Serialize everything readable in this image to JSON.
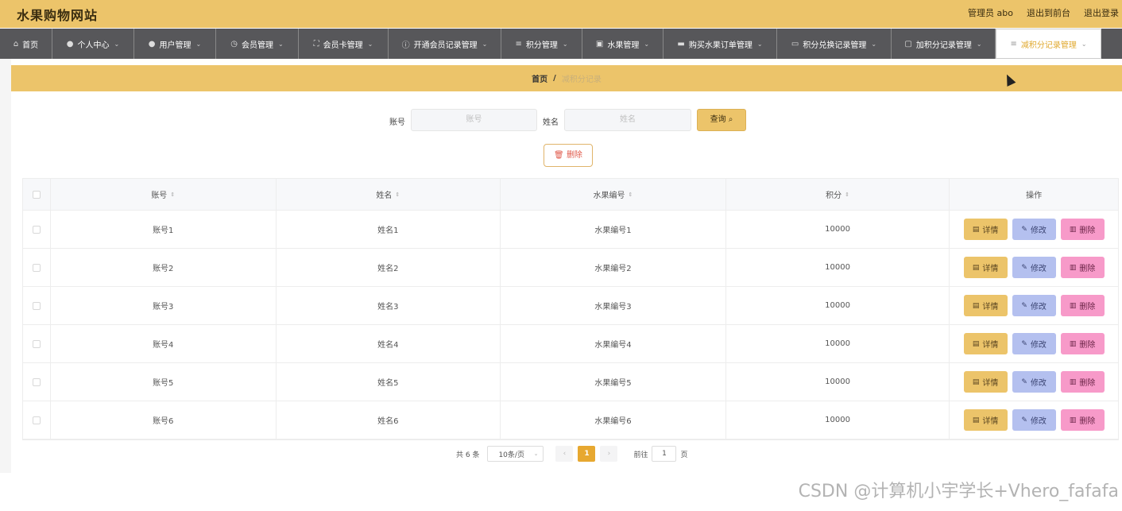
{
  "header": {
    "site_title": "水果购物网站",
    "admin_label": "管理员 abo",
    "back_front": "退出到前台",
    "logout": "退出登录"
  },
  "nav": {
    "items": [
      {
        "label": "首页",
        "icon": "home-icon"
      },
      {
        "label": "个人中心",
        "icon": "user-icon"
      },
      {
        "label": "用户管理",
        "icon": "user-icon"
      },
      {
        "label": "会员管理",
        "icon": "clock-icon"
      },
      {
        "label": "会员卡管理",
        "icon": "frame-icon"
      },
      {
        "label": "开通会员记录管理",
        "icon": "info-icon"
      },
      {
        "label": "积分管理",
        "icon": "menu-icon"
      },
      {
        "label": "水果管理",
        "icon": "image-icon"
      },
      {
        "label": "购买水果订单管理",
        "icon": "bag-icon"
      },
      {
        "label": "积分兑换记录管理",
        "icon": "card-icon"
      },
      {
        "label": "加积分记录管理",
        "icon": "chat-icon"
      },
      {
        "label": "减积分记录管理",
        "icon": "menu-icon"
      }
    ]
  },
  "breadcrumb": {
    "home": "首页",
    "separator": "/",
    "current": "减积分记录"
  },
  "search": {
    "account_label": "账号",
    "account_placeholder": "账号",
    "name_label": "姓名",
    "name_placeholder": "姓名",
    "query_button": "查询"
  },
  "toolbar": {
    "delete_label": "删除"
  },
  "table": {
    "headers": [
      "账号",
      "姓名",
      "水果编号",
      "积分",
      "操作"
    ],
    "rows": [
      [
        "账号1",
        "姓名1",
        "水果编号1",
        "10000"
      ],
      [
        "账号2",
        "姓名2",
        "水果编号2",
        "10000"
      ],
      [
        "账号3",
        "姓名3",
        "水果编号3",
        "10000"
      ],
      [
        "账号4",
        "姓名4",
        "水果编号4",
        "10000"
      ],
      [
        "账号5",
        "姓名5",
        "水果编号5",
        "10000"
      ],
      [
        "账号6",
        "姓名6",
        "水果编号6",
        "10000"
      ]
    ],
    "actions": {
      "detail": "详情",
      "edit": "修改",
      "delete": "删除"
    }
  },
  "pager": {
    "total": "共 6 条",
    "page_size": "10条/页",
    "current_page": "1",
    "goto_label": "前往",
    "goto_value": "1",
    "page_suffix": "页"
  },
  "watermark": "CSDN @计算机小宇学长+Vhero_fafafa",
  "colors": {
    "accent": "#ecc46a",
    "nav_bg": "#57575a",
    "edit": "#b4c0ef",
    "delete": "#f79ac9"
  }
}
